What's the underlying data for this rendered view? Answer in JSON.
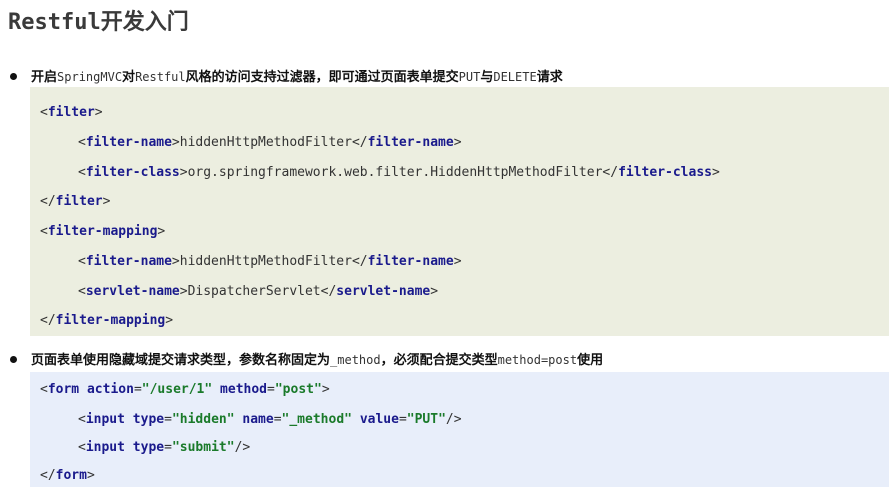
{
  "title": {
    "latin": "Restful",
    "cn": "开发入门"
  },
  "bullet1": {
    "parts": [
      "开启",
      "SpringMVC",
      "对",
      "Restful",
      "风格的访问支持过滤器，即可通过页面表单提交",
      "PUT",
      "与",
      "DELETE",
      "请求"
    ]
  },
  "code1": {
    "filter_tag": "filter",
    "filter_name_tag": "filter-name",
    "filter_name_value": "hiddenHttpMethodFilter",
    "filter_class_tag": "filter-class",
    "filter_class_value": "org.springframework.web.filter.HiddenHttpMethodFilter",
    "filter_mapping_tag": "filter-mapping",
    "servlet_name_tag": "servlet-name",
    "servlet_name_value": "DispatcherServlet"
  },
  "bullet2": {
    "parts": [
      "页面表单使用隐藏域提交请求类型，参数名称固定为",
      "_method",
      "，必须配合提交类型",
      "method=post",
      "使用"
    ]
  },
  "code2": {
    "form_tag": "form",
    "action_attr": "action",
    "action_value": "\"/user/1\"",
    "method_attr": "method",
    "method_value": "\"post\"",
    "input_tag": "input",
    "type_attr": "type",
    "type_hidden": "\"hidden\"",
    "name_attr": "name",
    "name_value": "\"_method\"",
    "value_attr": "value",
    "value_value": "\"PUT\"",
    "type_submit": "\"submit\""
  }
}
